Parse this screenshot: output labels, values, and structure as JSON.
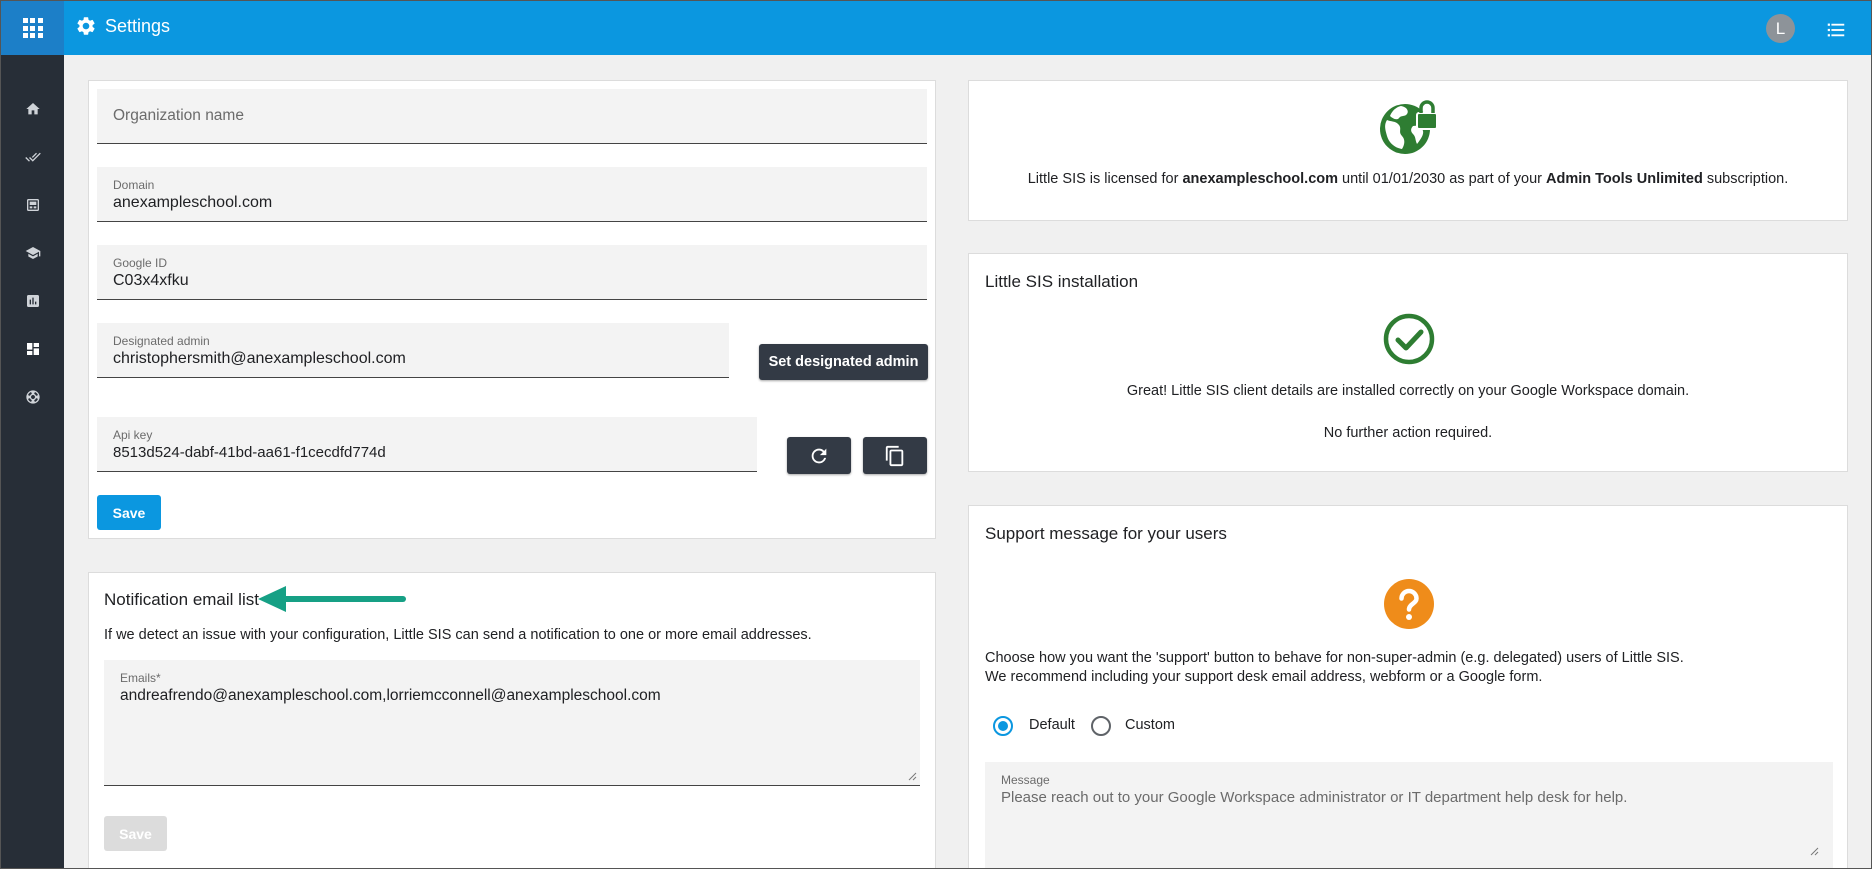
{
  "header": {
    "title": "Settings",
    "avatar_initial": "L",
    "brand_color": "#0b97e0"
  },
  "sidebar": {
    "items": [
      {
        "icon": "home-icon"
      },
      {
        "icon": "done-all-icon"
      },
      {
        "icon": "dashboard-card-icon"
      },
      {
        "icon": "school-icon"
      },
      {
        "icon": "bar-chart-icon"
      },
      {
        "icon": "layout-icon"
      },
      {
        "icon": "support-icon"
      }
    ]
  },
  "org_settings": {
    "org_name_placeholder": "Organization name",
    "domain_label": "Domain",
    "domain_value": "anexampleschool.com",
    "google_id_label": "Google ID",
    "google_id_value": "C03x4xfku",
    "admin_label": "Designated admin",
    "admin_value": "christophersmith@anexampleschool.com",
    "set_admin_button": "Set designated admin",
    "api_key_label": "Api key",
    "api_key_value": "8513d524-dabf-41bd-aa61-f1cecdfd774d",
    "save_button": "Save"
  },
  "notification": {
    "title": "Notification email list",
    "description": "If we detect an issue with your configuration, Little SIS can send a notification to one or more email addresses.",
    "emails_label": "Emails*",
    "emails_value": "andreafrendo@anexampleschool.com,lorriemcconnell@anexampleschool.com",
    "save_button": "Save",
    "arrow_color": "#16a085"
  },
  "license": {
    "text_prefix": "Little SIS is licensed for ",
    "domain": "anexampleschool.com",
    "text_middle": " until 01/01/2030 as part of your ",
    "plan": "Admin Tools Unlimited",
    "text_suffix": " subscription.",
    "icon_color": "#2e7d32"
  },
  "installation": {
    "title": "Little SIS installation",
    "status_line": "Great! Little SIS client details are installed correctly on your Google Workspace domain.",
    "action_line": "No further action required.",
    "icon_color": "#2e7d32"
  },
  "support": {
    "title": "Support message for your users",
    "line1": "Choose how you want the 'support' button to behave for non-super-admin (e.g. delegated) users of Little SIS.",
    "line2": "We recommend including your support desk email address, webform or a Google form.",
    "option_default": "Default",
    "option_custom": "Custom",
    "selected_option": "Default",
    "message_label": "Message",
    "message_placeholder": "Please reach out to your Google Workspace administrator or IT department help desk for help.",
    "icon_color": "#ef8c1a"
  }
}
